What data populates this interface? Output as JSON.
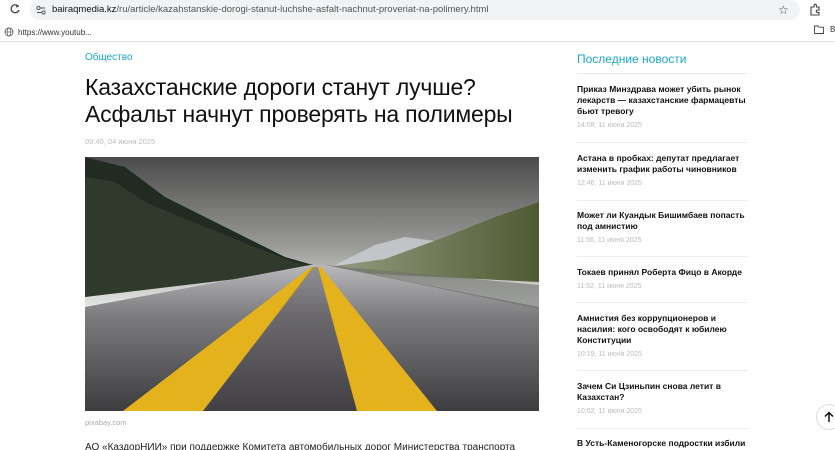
{
  "browser": {
    "url_host": "bairaqmedia.kz",
    "url_path": "/ru/article/kazahstanskie-dorogi-stanut-luchshe-asfalt-nachnut-proveriat-na-polimery.html",
    "bookmark_label": "https://www.youtub...",
    "bookmark_right_label": "В"
  },
  "article": {
    "category": "Общество",
    "title": "Казахстанские дороги станут лучше? Асфальт начнут проверять на полимеры",
    "date": "09:40, 04 июня 2025",
    "image_caption": "pixabay.com",
    "body_start": "АО «КаздорНИИ» при поддержке Комитета автомобильных дорог Министерства транспорта"
  },
  "sidebar": {
    "heading": "Последние новости",
    "items": [
      {
        "title": "Приказ Минздрава может убить рынок лекарств — казахстанские фармацевты бьют тревогу",
        "time": "14:08, 11 июня 2025"
      },
      {
        "title": "Астана в пробках: депутат предлагает изменить график работы чиновников",
        "time": "12:46, 11 июня 2025"
      },
      {
        "title": "Может ли Куандык Бишимбаев попасть под амнистию",
        "time": "11:56, 11 июня 2025"
      },
      {
        "title": "Токаев принял Роберта Фицо в Акорде",
        "time": "11:52, 11 июня 2025"
      },
      {
        "title": "Амнистия без коррупционеров и насилия: кого освободят к юбилею Конституции",
        "time": "10:19, 11 июня 2025"
      },
      {
        "title": "Зачем Си Цзиньпин снова летит в Казахстан?",
        "time": "10:02, 11 июня 2025"
      },
      {
        "title": "В Усть-Каменогорске подростки избили",
        "time": ""
      }
    ]
  },
  "colors": {
    "accent": "#1aa7c7",
    "road_line": "#e4b21c"
  },
  "icons": {
    "reload": "reload-icon",
    "star": "star-icon",
    "extensions": "extensions-icon",
    "folder": "folder-icon",
    "scroll_top": "arrow-up-icon"
  }
}
